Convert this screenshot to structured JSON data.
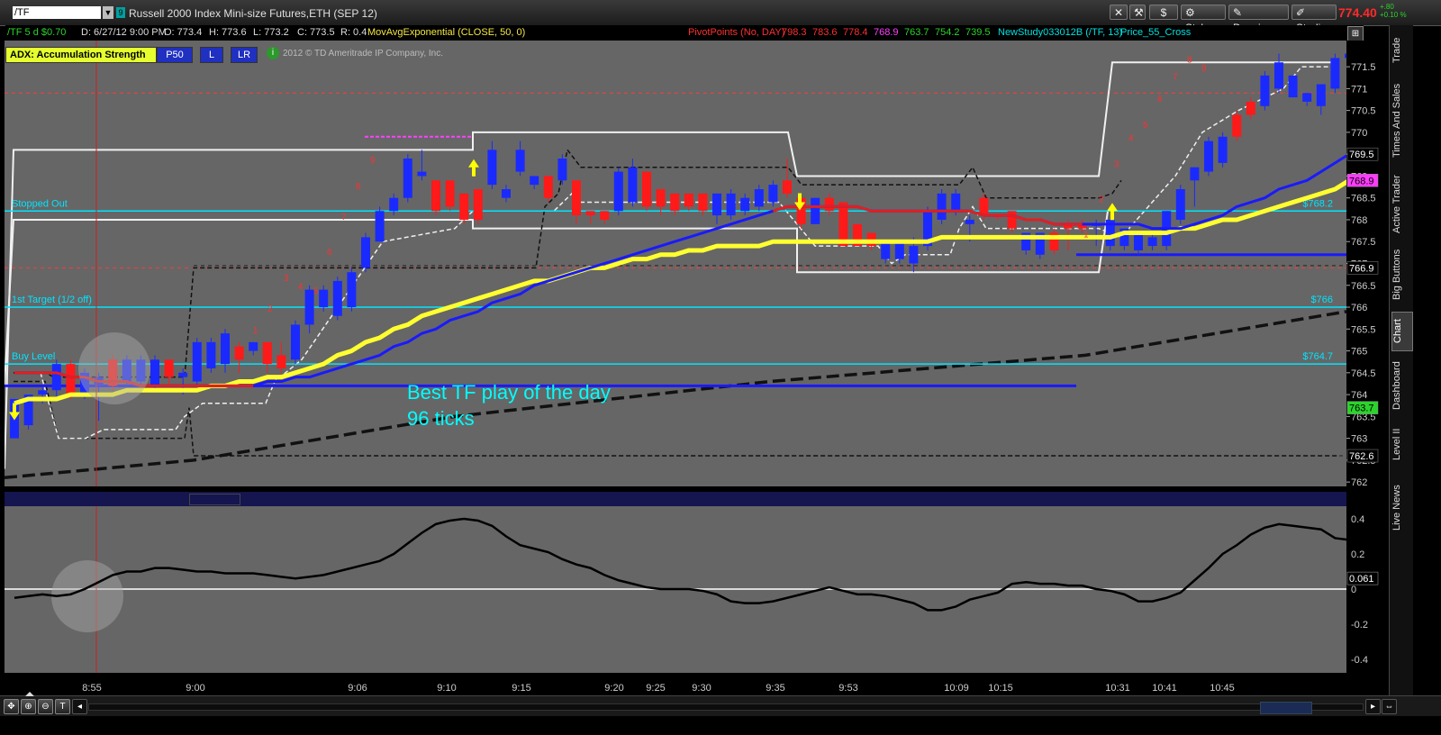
{
  "toolbar": {
    "symbol_value": "/TF",
    "description": "Russell 2000 Index Mini-size Futures,ETH (SEP 12)",
    "dollar_btn": "$",
    "style_btn": "Style",
    "drawings_btn": "Drawings",
    "studies_btn": "Studies",
    "last_price": "774.40",
    "net_change": "+.80",
    "pct_change": "+0.10 %"
  },
  "infobar": {
    "sym": "/TF 5 d $0.70",
    "date": "D: 6/27/12 9:00 PM",
    "open": "O: 773.4",
    "high": "H: 773.6",
    "low": "L: 773.2",
    "close": "C: 773.5",
    "range": "R: 0.4",
    "mav": "MovAvgExponential (CLOSE, 50, 0)",
    "pivot_label": "PivotPoints (No, DAY)",
    "pivots": [
      "798.3",
      "783.6",
      "778.4",
      "768.9",
      "763.7",
      "754.2",
      "739.5"
    ],
    "pivot_colors": [
      "#ff3030",
      "#ff3030",
      "#ff3030",
      "#ff40ff",
      "#2bd42b",
      "#2bd42b",
      "#2bd42b"
    ],
    "newstudy": "NewStudy033012B (/TF, 13)",
    "cross": "Price_55_Cross"
  },
  "study_buttons": {
    "adx": "ADX: Accumulation Strength",
    "p50": "P50",
    "l": "L",
    "lr": "LR",
    "copyright": "2012 © TD Ameritrade IP Company, Inc."
  },
  "levels": [
    {
      "label": "Stopped Out",
      "price": "$768.2",
      "value": 768.2
    },
    {
      "label": "1st Target (1/2 off)",
      "price": "$766",
      "value": 766
    },
    {
      "label": "Buy Level",
      "price": "$764.7",
      "value": 764.7
    }
  ],
  "annotation": {
    "line1": "Best TF play of the day",
    "line2": "96 ticks"
  },
  "price_axis": {
    "ticks": [
      "771.5",
      "771",
      "770.5",
      "770",
      "769.5",
      "769",
      "768.5",
      "768",
      "767.5",
      "767",
      "766.5",
      "766",
      "765.5",
      "765",
      "764.5",
      "764",
      "763.5",
      "763",
      "762.5",
      "762"
    ],
    "markers": [
      {
        "text": "769.5",
        "bg": "#000",
        "fg": "#fff",
        "value": 769.5
      },
      {
        "text": "768.9",
        "bg": "#ff3aff",
        "fg": "#000",
        "value": 768.9
      },
      {
        "text": "766.9",
        "bg": "#000",
        "fg": "#fff",
        "value": 766.9
      },
      {
        "text": "763.7",
        "bg": "#2bd42b",
        "fg": "#000",
        "value": 763.7
      },
      {
        "text": "762.6",
        "bg": "#000",
        "fg": "#fff",
        "value": 762.6
      }
    ]
  },
  "lower_axis": {
    "ticks": [
      "0.4",
      "0.2",
      "0",
      "-0.2",
      "-0.4"
    ],
    "marker": "0.061"
  },
  "time_axis": [
    "8:55",
    "9:00",
    "9:06",
    "9:10",
    "9:15",
    "9:20",
    "9:25",
    "9:30",
    "9:35",
    "9:53",
    "10:09",
    "10:15",
    "10:31",
    "10:41",
    "10:45"
  ],
  "sidebar_tabs": [
    "Trade",
    "Times And Sales",
    "Active Trader",
    "Big Buttons",
    "Chart",
    "Dashboard",
    "Level II",
    "Live News"
  ],
  "chart_data": {
    "type": "candlestick",
    "ylim": [
      761.9,
      772.1
    ],
    "candles": [
      [
        763.9,
        763.9,
        763.0,
        763.0
      ],
      [
        763.3,
        764.0,
        763.2,
        764.0
      ],
      [
        764.0,
        764.2,
        763.8,
        764.1
      ],
      [
        764.1,
        764.8,
        763.9,
        764.7
      ],
      [
        764.7,
        764.8,
        763.9,
        764.0
      ],
      [
        764.0,
        764.6,
        763.9,
        764.5
      ],
      [
        764.4,
        764.5,
        763.4,
        764.2
      ],
      [
        764.2,
        764.9,
        764.1,
        764.8
      ],
      [
        764.3,
        764.9,
        764.2,
        764.8
      ],
      [
        764.3,
        764.9,
        764.2,
        764.8
      ],
      [
        764.2,
        764.9,
        764.1,
        764.8
      ],
      [
        764.8,
        764.8,
        764.2,
        764.4
      ],
      [
        764.4,
        764.6,
        764.0,
        764.5
      ],
      [
        764.3,
        765.3,
        764.2,
        765.2
      ],
      [
        764.6,
        765.3,
        764.5,
        765.2
      ],
      [
        764.7,
        765.5,
        764.5,
        765.4
      ],
      [
        765.1,
        765.2,
        764.5,
        764.8
      ],
      [
        765.0,
        765.2,
        764.9,
        765.2
      ],
      [
        765.2,
        765.2,
        764.5,
        764.7
      ],
      [
        764.9,
        765.2,
        764.5,
        764.6
      ],
      [
        764.8,
        765.7,
        764.7,
        765.6
      ],
      [
        765.6,
        766.5,
        765.4,
        766.4
      ],
      [
        766.0,
        766.5,
        765.9,
        766.4
      ],
      [
        765.8,
        766.7,
        765.7,
        766.6
      ],
      [
        766.0,
        766.9,
        765.9,
        766.8
      ],
      [
        766.9,
        767.7,
        766.8,
        767.6
      ],
      [
        767.5,
        768.3,
        767.5,
        768.2
      ],
      [
        768.2,
        768.6,
        768.1,
        768.5
      ],
      [
        768.5,
        769.5,
        768.4,
        769.4
      ],
      [
        769.0,
        769.6,
        768.9,
        769.1
      ],
      [
        768.9,
        768.9,
        768.1,
        768.2
      ],
      [
        768.9,
        768.9,
        768.2,
        768.3
      ],
      [
        768.6,
        768.6,
        767.9,
        768.0
      ],
      [
        768.7,
        768.7,
        767.9,
        768.0
      ],
      [
        768.8,
        769.8,
        768.7,
        769.6
      ],
      [
        768.5,
        768.8,
        768.4,
        768.7
      ],
      [
        769.1,
        769.8,
        769.0,
        769.6
      ],
      [
        768.8,
        769.0,
        768.7,
        769.0
      ],
      [
        769.0,
        769.0,
        768.4,
        768.5
      ],
      [
        768.9,
        769.5,
        768.8,
        769.4
      ],
      [
        768.9,
        768.9,
        767.9,
        768.1
      ],
      [
        768.2,
        768.2,
        767.9,
        768.1
      ],
      [
        768.2,
        768.2,
        767.9,
        768.0
      ],
      [
        768.2,
        769.2,
        768.1,
        769.1
      ],
      [
        768.4,
        769.4,
        768.3,
        769.2
      ],
      [
        769.1,
        769.1,
        768.2,
        768.3
      ],
      [
        768.7,
        768.7,
        768.1,
        768.3
      ],
      [
        768.6,
        768.6,
        768.1,
        768.2
      ],
      [
        768.6,
        768.6,
        768.2,
        768.3
      ],
      [
        768.6,
        768.6,
        768.1,
        768.2
      ],
      [
        768.6,
        768.6,
        767.9,
        768.1
      ],
      [
        768.1,
        768.7,
        768.0,
        768.6
      ],
      [
        768.2,
        768.6,
        768.1,
        768.5
      ],
      [
        768.3,
        768.8,
        768.2,
        768.7
      ],
      [
        768.4,
        768.9,
        768.3,
        768.8
      ],
      [
        768.6,
        769.4,
        768.5,
        768.9
      ],
      [
        768.5,
        768.5,
        767.8,
        767.9
      ],
      [
        768.5,
        768.5,
        767.9,
        767.9
      ],
      [
        768.2,
        768.6,
        768.1,
        768.5
      ],
      [
        768.4,
        768.4,
        767.4,
        767.4
      ],
      [
        767.9,
        767.9,
        767.4,
        767.4
      ],
      [
        767.7,
        767.7,
        767.3,
        767.4
      ],
      [
        767.5,
        767.5,
        767.0,
        767.1
      ],
      [
        767.5,
        767.5,
        767.0,
        767.1
      ],
      [
        767.0,
        767.6,
        766.8,
        767.4
      ],
      [
        767.4,
        768.3,
        767.3,
        768.2
      ],
      [
        768.0,
        768.7,
        767.9,
        768.6
      ],
      [
        768.2,
        768.7,
        768.1,
        768.6
      ],
      [
        767.9,
        768.1,
        767.5,
        768.0
      ],
      [
        768.1,
        768.6,
        768.0,
        768.5
      ],
      [
        768.1,
        768.1,
        768.0,
        768.1
      ],
      [
        768.2,
        768.2,
        767.7,
        767.8
      ],
      [
        767.7,
        767.7,
        767.2,
        767.3
      ],
      [
        767.7,
        767.7,
        767.1,
        767.2
      ],
      [
        767.3,
        767.8,
        767.2,
        767.7
      ],
      [
        767.8,
        768.0,
        767.3,
        767.9
      ],
      [
        767.8,
        768.0,
        767.7,
        767.9
      ],
      [
        767.9,
        768.0,
        767.4,
        767.9
      ],
      [
        768.0,
        768.0,
        767.3,
        767.4
      ],
      [
        767.8,
        767.8,
        767.3,
        767.4
      ],
      [
        767.7,
        767.7,
        767.2,
        767.3
      ],
      [
        767.4,
        767.7,
        767.3,
        767.6
      ],
      [
        767.4,
        768.2,
        767.3,
        768.2
      ],
      [
        768.0,
        768.8,
        767.9,
        768.7
      ],
      [
        768.9,
        769.2,
        768.3,
        769.2
      ],
      [
        769.1,
        769.9,
        769.0,
        769.8
      ],
      [
        769.3,
        770.0,
        769.2,
        769.9
      ],
      [
        769.9,
        770.5,
        769.8,
        770.4
      ],
      [
        770.4,
        770.8,
        770.3,
        770.7
      ],
      [
        770.6,
        771.4,
        770.5,
        771.3
      ],
      [
        771.0,
        771.8,
        770.9,
        771.6
      ],
      [
        771.3,
        771.3,
        770.8,
        770.8
      ],
      [
        770.9,
        770.9,
        770.6,
        770.7
      ],
      [
        770.6,
        771.1,
        770.4,
        771.1
      ],
      [
        771.0,
        771.8,
        770.9,
        771.7
      ],
      [
        771.7,
        771.9,
        771.6,
        771.8
      ],
      [
        771.8,
        771.9,
        771.7,
        771.9
      ],
      [
        771.9,
        771.9,
        771.8,
        771.9
      ],
      [
        771.8,
        771.9,
        771.7,
        771.8
      ]
    ],
    "candle_colors": "bbbbrbbrbbbrbbbbrbrrbbbbbbbbbbrrrrbbbbrbrrrbbrrrrrbbbbbrrbrrrrbbbbbbbrrrbbrrrbbbbbbbbbbrrbbbbbb",
    "ema50": [
      764.5,
      764.5,
      764.5,
      764.5,
      764.4,
      764.4,
      764.3,
      764.3,
      764.3,
      764.2,
      764.2,
      764.2,
      764.2,
      764.2,
      764.2,
      764.2,
      764.2,
      764.2,
      764.3,
      764.3,
      764.4,
      764.4,
      764.5,
      764.6,
      764.7,
      764.8,
      764.9,
      765.1,
      765.2,
      765.4,
      765.5,
      765.7,
      765.8,
      765.9,
      766.1,
      766.2,
      766.3,
      766.5,
      766.6,
      766.7,
      766.8,
      766.9,
      767.0,
      767.1,
      767.2,
      767.3,
      767.4,
      767.5,
      767.6,
      767.7,
      767.8,
      767.9,
      768.0,
      768.1,
      768.2,
      768.3,
      768.3,
      768.3,
      768.3,
      768.3,
      768.3,
      768.2,
      768.2,
      768.2,
      768.2,
      768.2,
      768.2,
      768.2,
      768.2,
      768.1,
      768.1,
      768.1,
      768.0,
      768.0,
      767.9,
      767.9,
      767.9,
      767.9,
      767.9,
      767.9,
      767.9,
      767.8,
      767.8,
      767.8,
      767.9,
      768.0,
      768.1,
      768.3,
      768.4,
      768.5,
      768.7,
      768.8,
      768.9,
      769.1,
      769.3,
      769.5,
      769.7,
      769.9,
      770.0
    ],
    "yellow_ma": [
      763.8,
      763.9,
      763.9,
      763.9,
      764.0,
      764.0,
      764.0,
      764.0,
      764.1,
      764.1,
      764.1,
      764.1,
      764.1,
      764.1,
      764.2,
      764.2,
      764.3,
      764.3,
      764.4,
      764.4,
      764.5,
      764.6,
      764.7,
      764.9,
      765.0,
      765.2,
      765.3,
      765.5,
      765.6,
      765.8,
      765.9,
      766.0,
      766.1,
      766.2,
      766.3,
      766.4,
      766.5,
      766.6,
      766.6,
      766.7,
      766.8,
      766.9,
      766.9,
      767.0,
      767.1,
      767.1,
      767.2,
      767.2,
      767.3,
      767.3,
      767.4,
      767.4,
      767.4,
      767.4,
      767.5,
      767.5,
      767.5,
      767.5,
      767.5,
      767.5,
      767.5,
      767.5,
      767.5,
      767.5,
      767.5,
      767.5,
      767.6,
      767.6,
      767.6,
      767.6,
      767.6,
      767.6,
      767.6,
      767.6,
      767.6,
      767.6,
      767.6,
      767.6,
      767.6,
      767.7,
      767.7,
      767.7,
      767.7,
      767.8,
      767.8,
      767.9,
      768.0,
      768.0,
      768.1,
      768.2,
      768.3,
      768.4,
      768.5,
      768.6,
      768.7,
      768.9,
      769.0,
      769.2,
      769.4
    ],
    "oscillator": [
      -0.05,
      -0.04,
      -0.03,
      -0.04,
      -0.03,
      0.0,
      0.04,
      0.08,
      0.1,
      0.1,
      0.12,
      0.12,
      0.11,
      0.1,
      0.1,
      0.09,
      0.09,
      0.09,
      0.08,
      0.07,
      0.06,
      0.07,
      0.08,
      0.1,
      0.12,
      0.14,
      0.16,
      0.2,
      0.26,
      0.32,
      0.37,
      0.39,
      0.4,
      0.39,
      0.36,
      0.3,
      0.25,
      0.23,
      0.21,
      0.17,
      0.14,
      0.12,
      0.08,
      0.05,
      0.03,
      0.01,
      0.0,
      0.0,
      0.0,
      -0.01,
      -0.03,
      -0.07,
      -0.08,
      -0.08,
      -0.07,
      -0.05,
      -0.03,
      -0.01,
      0.01,
      -0.01,
      -0.03,
      -0.03,
      -0.04,
      -0.06,
      -0.08,
      -0.12,
      -0.12,
      -0.1,
      -0.06,
      -0.04,
      -0.02,
      0.03,
      0.04,
      0.03,
      0.03,
      0.02,
      0.02,
      0.0,
      -0.01,
      -0.03,
      -0.07,
      -0.07,
      -0.05,
      -0.02,
      0.05,
      0.12,
      0.2,
      0.25,
      0.31,
      0.35,
      0.37,
      0.36,
      0.35,
      0.34,
      0.29,
      0.28,
      0.25,
      0.22,
      0.17
    ]
  }
}
